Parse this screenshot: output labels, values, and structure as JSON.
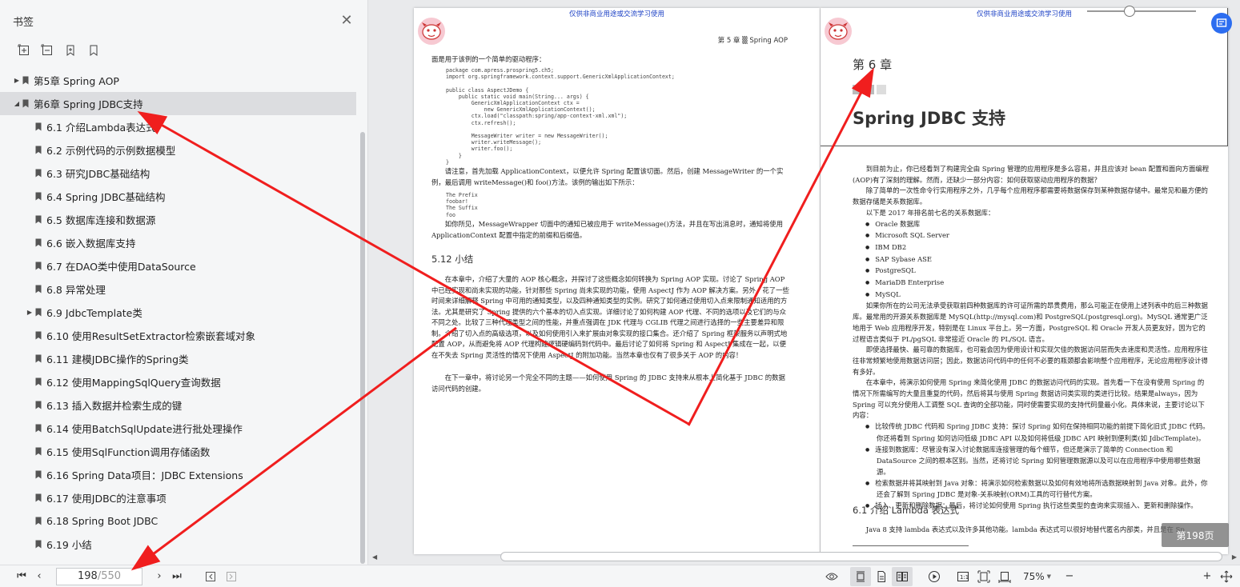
{
  "sidebar": {
    "title": "书签",
    "close_icon": "close-icon",
    "tools": [
      "expand-all-icon",
      "collapse-all-icon",
      "add-bookmark-icon",
      "bookmark-icon"
    ],
    "items": [
      {
        "label": "第5章 Spring AOP",
        "level": 1,
        "expander": "collapsed"
      },
      {
        "label": "第6章 Spring JDBC支持",
        "level": 1,
        "expander": "expanded",
        "selected": true
      },
      {
        "label": "6.1 介绍Lambda表达式",
        "level": 2
      },
      {
        "label": "6.2 示例代码的示例数据模型",
        "level": 2
      },
      {
        "label": "6.3 研究JDBC基础结构",
        "level": 2
      },
      {
        "label": "6.4 Spring JDBC基础结构",
        "level": 2
      },
      {
        "label": "6.5 数据库连接和数据源",
        "level": 2
      },
      {
        "label": "6.6 嵌入数据库支持",
        "level": 2
      },
      {
        "label": "6.7 在DAO类中使用DataSource",
        "level": 2
      },
      {
        "label": "6.8 异常处理",
        "level": 2
      },
      {
        "label": "6.9 JdbcTemplate类",
        "level": 2,
        "expander": "collapsed"
      },
      {
        "label": "6.10 使用ResultSetExtractor检索嵌套域对象",
        "level": 2
      },
      {
        "label": "6.11 建模JDBC操作的Spring类",
        "level": 2
      },
      {
        "label": "6.12 使用MappingSqlQuery查询数据",
        "level": 2
      },
      {
        "label": "6.13 插入数据并检索生成的键",
        "level": 2
      },
      {
        "label": "6.14 使用BatchSqlUpdate进行批处理操作",
        "level": 2
      },
      {
        "label": "6.15 使用SqlFunction调用存储函数",
        "level": 2
      },
      {
        "label": "6.16 Spring Data项目：JDBC Extensions",
        "level": 2
      },
      {
        "label": "6.17 使用JDBC的注意事项",
        "level": 2
      },
      {
        "label": "6.18 Spring Boot JDBC",
        "level": 2
      },
      {
        "label": "6.19 小结",
        "level": 2
      }
    ]
  },
  "left_page": {
    "watermark": "仅供非商业用途或交流学习使用",
    "header": "第 5 章  ▒  Spring AOP",
    "intro": "面是用于该例的一个简单的驱动程序：",
    "code1": "package com.apress.prospring5.ch5;\nimport org.springframework.context.support.GenericXmlApplicationContext;\n\npublic class AspectJDemo {\n    public static void main(String... args) {\n        GenericXmlApplicationContext ctx =\n            new GenericXmlApplicationContext();\n        ctx.load(\"classpath:spring/app-context-xml.xml\");\n        ctx.refresh();\n\n        MessageWriter writer = new MessageWriter();\n        writer.writeMessage();\n        writer.foo();\n    }\n}",
    "para1": "请注意，首先加载 ApplicationContext，以便允许 Spring 配置该切面。然后，创建 MessageWriter 的一个实例，最后调用 writeMessage()和 foo()方法。该例的输出如下所示：",
    "code2": "The Prefix\nfoobar!\nThe Suffix\nfoo",
    "para2": "如你所见，MessageWrapper 切面中的通知已被应用于 writeMessage()方法，并且在写出消息时，通知将使用 ApplicationContext 配置中指定的前缀和后缀值。",
    "section": "5.12   小结",
    "para3": "在本章中，介绍了大量的 AOP 核心概念，并探讨了这些概念如何转换为 Spring AOP 实现。讨论了 Spring AOP 中已经实现和尚未实现的功能，针对那些 Spring 尚未实现的功能，使用 AspectJ 作为 AOP 解决方案。另外，花了一些时间来详细解释 Spring 中可用的通知类型，以及四种通知类型的实例。研究了如何通过使用切入点来限制通知适用的方法。尤其是研究了 Spring 提供的六个基本的切入点实现。详细讨论了如何构建 AOP 代理、不同的选项以及它们的与众不同之处。比较了三种代理类型之间的性能，并重点强调在 JDK 代理与 CGLIB 代理之间进行选择的一些主要差异和限制。介绍了切入点的高级选项，以及如何使用引入来扩展由对象实现的接口集合。还介绍了 Spring 框架服务以声明式地配置 AOP，从而避免将 AOP 代理构建逻辑硬编码到代码中。最后讨论了如何将 Spring 和 AspectJ 集成在一起，以便在不失去 Spring 灵活性的情况下使用 AspectJ 的附加功能。当然本章也仅有了很多关于 AOP 的内容！",
    "para4": "在下一章中，将讨论另一个完全不同的主题——如何使用 Spring 的 JDBC 支持来从根本上简化基于 JDBC 的数据访问代码的创建。"
  },
  "right_page": {
    "watermark": "仅供非商业用途或交流学习使用",
    "chapter_label": "第 6 章",
    "chapter_title": "Spring JDBC 支持",
    "para1": "到目前为止，你已经看到了构建完全由 Spring 管理的应用程序是多么容易，并且应该对 bean 配置和面向方面编程(AOP)有了深刻的理解。然而，还缺少一部分内容：如何获取驱动应用程序的数据？",
    "para2": "除了简单的一次性命令行实用程序之外，几乎每个应用程序都需要将数据保存到某种数据存储中。最常见和最方便的数据存储是关系数据库。",
    "para3": "以下是 2017 年排名前七名的关系数据库：",
    "databases": [
      "Oracle 数据库",
      "Microsoft SQL Server",
      "IBM DB2",
      "SAP Sybase ASE",
      "PostgreSQL",
      "MariaDB Enterprise",
      "MySQL"
    ],
    "para4": "如果你所在的公司无法承受获取前四种数据库的许可证所需的昂贵费用，那么可能正在使用上述列表中的后三种数据库。最常用的开源关系数据库是 MySQL(http://mysql.com)和 PostgreSQL(postgresql.org)。MySQL 通常更广泛地用于 Web 应用程序开发，特别是在 Linux 平台上。另一方面，PostgreSQL 和 Oracle 开发人员更友好，因为它的过程语言类似于 PL/pgSQL 非常接近 Oracle 的 PL/SQL 语言。",
    "para5": "即使选择最快、最可靠的数据库，也可能会因为使用设计和实现欠佳的数据访问层而失去速度和灵活性。应用程序往往非常频繁地使用数据访问层；因此，数据访问代码中的任何不必要的瓶颈都会影响整个应用程序，无论应用程序设计得有多好。",
    "para6": "在本章中，将演示如何使用 Spring 来简化使用 JDBC 的数据访问代码的实现。首先看一下在没有使用 Spring 的情况下所需编写的大量且重复的代码，然后将其与使用 Spring 数据访问类实现的类进行比较。结果是always，因为 Spring 可以充分使用人工调整 SQL 查询的全部功能，同时使需要实现的支持代码量最小化。具体来说，主要讨论以下内容：",
    "topics": [
      "比较传统 JDBC 代码和 Spring JDBC 支持：探讨 Spring 如何在保持相同功能的前提下简化旧式 JDBC 代码。你还将看到 Spring 如何访问低级 JDBC API 以及如何将低级 JDBC API 映射到便利类(如 JdbcTemplate)。",
      "连接到数据库：尽管没有深入讨论数据库连接管理的每个细节，但还是演示了简单的 Connection 和 DataSource 之间的根本区别。当然，还将讨论 Spring 如何管理数据源以及可以在应用程序中使用哪些数据源。",
      "检索数据并将其映射到 Java 对象：将演示如何检索数据以及如何有效地将所选数据映射到 Java 对象。此外，你还会了解到 Spring JDBC 是对象-关系映射(ORM)工具的可行替代方案。",
      "插入、更新和删除数据：最后，将讨论如何使用 Spring 执行这些类型的查询来实现插入、更新和删除操作。"
    ],
    "section": "6.1   介绍 Lambda 表达式",
    "para7": "Java 8 支持 lambda 表达式以及许多其他功能。lambda 表达式可以很好地替代匿名内部类，并且是在 Sp"
  },
  "overlay": {
    "page_badge": "第198页",
    "float_button_icon": "reader-mode-icon"
  },
  "bottombar": {
    "first_icon": "first-page-icon",
    "prev_icon": "prev-page-icon",
    "current_page": "198",
    "total_pages": "/550",
    "next_icon": "next-page-icon",
    "last_icon": "last-page-icon",
    "back_icon": "back-icon",
    "forward_icon": "forward-icon",
    "view_icons": [
      "eye-icon",
      "single-page-icon",
      "continuous-page-icon",
      "double-page-icon",
      "play-icon",
      "actual-size-icon",
      "fit-page-icon",
      "fit-width-icon"
    ],
    "zoom": "75%",
    "zoom_out": "−",
    "zoom_in": "+",
    "zoom_level": 0.39,
    "fullscreen_icon": "fullscreen-icon"
  },
  "annotations": {
    "arrow_color": "#f01e1e"
  }
}
